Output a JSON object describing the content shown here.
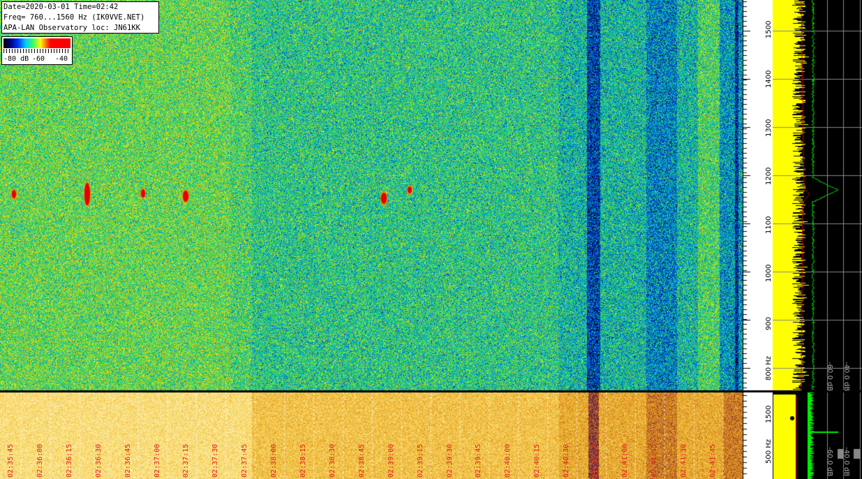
{
  "info": {
    "line1": "Date=2020-03-01 Time=02:42",
    "line2": "Freq= 760...1560 Hz (IK0VVE.NET)",
    "line3": "APA-LAN Observatory loc: JN61KK"
  },
  "legend": {
    "label_m80": "-80 dB",
    "label_m60": "-60",
    "label_m40": "-40"
  },
  "upper_axis": {
    "unit": "Hz",
    "ticks": [
      "1500",
      "1400",
      "1300",
      "1200",
      "1100",
      "1000",
      "900",
      "800 Hz"
    ]
  },
  "upper_level_axis": [
    "-60.0 dB",
    "-40.0 dB"
  ],
  "lower_axis": {
    "ticks": [
      "1500",
      "500 Hz"
    ]
  },
  "lower_level_axis": [
    "-60.0 dB",
    "-40.0 dB"
  ],
  "time_labels": [
    "02:35:45",
    "02:36:00",
    "02:36:15",
    "02:36:30",
    "02:36:45",
    "02:37:00",
    "02:37:15",
    "02:37:30",
    "02:37:45",
    "02:38:00",
    "02:38:15",
    "02:38:30",
    "02:38:45",
    "02:39:00",
    "02:39:15",
    "02:39:30",
    "02:39:45",
    "02:40:00",
    "02:40:15",
    "02:40:30",
    "02:40:45",
    "02:41:00",
    "02:41:15",
    "02:41:30",
    "02:41:45"
  ],
  "colors": {
    "spectrum_fill": "#ffff00",
    "level_trace": "#00cc00",
    "peak_trace": "#cc0000",
    "time_label": "#e02020"
  }
}
